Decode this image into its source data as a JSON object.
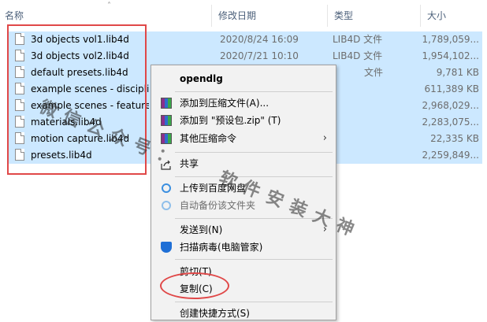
{
  "header": {
    "col_name": "名称",
    "col_date": "修改日期",
    "col_type": "类型",
    "col_size": "大小"
  },
  "files": [
    {
      "name": "3d objects vol1.lib4d",
      "date": "2020/8/24 16:09",
      "type": "LIB4D 文件",
      "size": "1,789,059..."
    },
    {
      "name": "3d objects vol2.lib4d",
      "date": "2020/7/21 10:10",
      "type": "LIB4D 文件",
      "size": "1,954,102..."
    },
    {
      "name": "default presets.lib4d",
      "date": "",
      "type": "文件",
      "size": "9,781 KB"
    },
    {
      "name": "example scenes - disciplin",
      "date": "",
      "type": "",
      "size": "611,389 KB"
    },
    {
      "name": "example scenes - features",
      "date": "",
      "type": "",
      "size": "2,968,029..."
    },
    {
      "name": "materials.lib4d",
      "date": "",
      "type": "",
      "size": "2,283,075..."
    },
    {
      "name": "motion capture.lib4d",
      "date": "",
      "type": "",
      "size": "22,335 KB"
    },
    {
      "name": "presets.lib4d",
      "date": "",
      "type": "",
      "size": "2,259,849..."
    }
  ],
  "menu": {
    "open": "opendlg",
    "add_archive": "添加到压缩文件(A)...",
    "add_zip": "添加到 \"预设包.zip\" (T)",
    "other_compress": "其他压缩命令",
    "share": "共享",
    "upload_baidu": "上传到百度网盘",
    "auto_backup": "自动备份该文件夹",
    "send_to": "发送到(N)",
    "scan_virus": "扫描病毒(电脑管家)",
    "cut": "剪切(T)",
    "copy": "复制(C)",
    "create_shortcut": "创建快捷方式(S)"
  },
  "watermark": {
    "line1": "微信公众号：",
    "line2": "软件安装大神"
  },
  "icons": {
    "file": "file-icon",
    "archive": "winrar-icon",
    "share": "share-icon",
    "cloud": "baidu-cloud-icon",
    "shield": "shield-icon",
    "submenu": "chevron-right-icon"
  }
}
